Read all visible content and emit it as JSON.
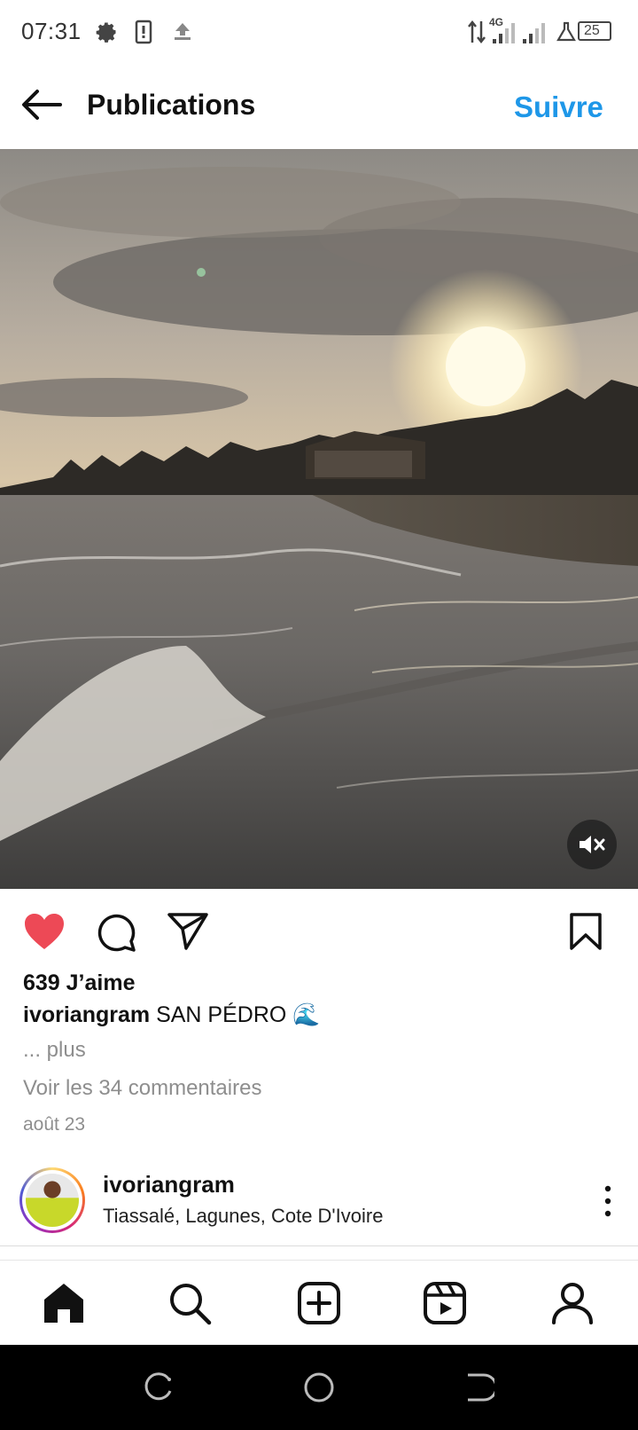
{
  "status_bar": {
    "time": "07:31",
    "network": "4G",
    "battery": "25"
  },
  "header": {
    "title": "Publications",
    "follow_label": "Suivre",
    "back_icon": "arrow-left-icon"
  },
  "post": {
    "media_description_icon": "video",
    "likes": "639 J’aime",
    "caption_user": "ivoriangram",
    "caption_text": "SAN PÉDRO",
    "caption_emoji": "🌊",
    "more_label": "... plus",
    "comments_label": "Voir les 34 commentaires",
    "date": "août 23",
    "liked": true,
    "like_color": "#ed4956"
  },
  "next_post": {
    "username": "ivoriangram",
    "location": "Tiassalé, Lagunes, Cote D'Ivoire"
  },
  "bottom_nav": [
    "home",
    "search",
    "create",
    "reels",
    "profile"
  ],
  "colors": {
    "accent": "#1e97e8"
  }
}
